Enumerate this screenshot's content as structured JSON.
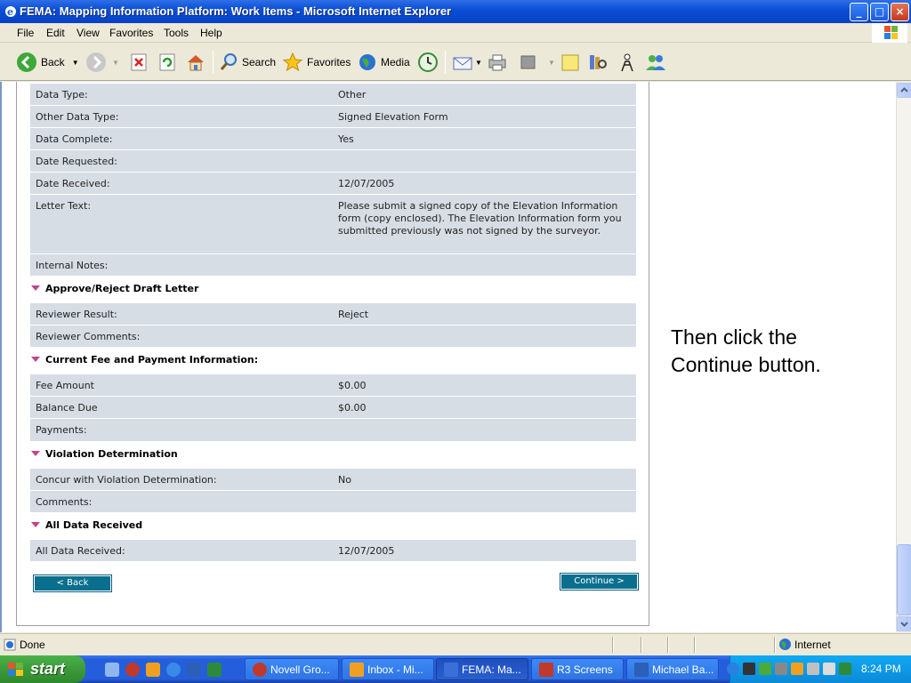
{
  "window": {
    "title": "FEMA: Mapping Information Platform: Work Items - Microsoft Internet Explorer",
    "min_glyph": "_",
    "max_glyph": "□",
    "close_glyph": "×"
  },
  "menu": {
    "items": [
      "File",
      "Edit",
      "View",
      "Favorites",
      "Tools",
      "Help"
    ]
  },
  "toolbar": {
    "back_label": "Back",
    "search_label": "Search",
    "favorites_label": "Favorites",
    "media_label": "Media"
  },
  "form": {
    "rows_top": [
      {
        "label": "Data Type:",
        "value": "Other"
      },
      {
        "label": "Other Data Type:",
        "value": "Signed Elevation Form"
      },
      {
        "label": "Data Complete:",
        "value": "Yes"
      },
      {
        "label": "Date Requested:",
        "value": ""
      },
      {
        "label": "Date Received:",
        "value": "12/07/2005"
      },
      {
        "label": "Letter Text:",
        "value": "Please submit a signed copy of the Elevation Information form (copy enclosed). The Elevation Information form you submitted previously was not signed by the surveyor."
      },
      {
        "label": "Internal Notes:",
        "value": ""
      }
    ],
    "section_approve": {
      "title": "Approve/Reject Draft Letter",
      "rows": [
        {
          "label": "Reviewer Result:",
          "value": "Reject"
        },
        {
          "label": "Reviewer Comments:",
          "value": ""
        }
      ]
    },
    "section_fee": {
      "title": "Current Fee and Payment Information:",
      "rows": [
        {
          "label": "Fee Amount",
          "value": "$0.00"
        },
        {
          "label": "Balance Due",
          "value": "$0.00"
        },
        {
          "label": "Payments:",
          "value": ""
        }
      ]
    },
    "section_violation": {
      "title": "Violation Determination",
      "rows": [
        {
          "label": "Concur with Violation Determination:",
          "value": "No"
        },
        {
          "label": "Comments:",
          "value": ""
        }
      ]
    },
    "section_all_data": {
      "title": "All Data Received",
      "rows": [
        {
          "label": "All Data Received:",
          "value": "12/07/2005"
        }
      ]
    },
    "back_button": "< Back",
    "continue_button": "Continue >"
  },
  "side_note": "Then click the Continue button.",
  "status": {
    "text": "Done",
    "zone": "Internet"
  },
  "taskbar": {
    "start_label": "start",
    "tasks": [
      {
        "label": "Novell Gro...",
        "color": "#c0392b"
      },
      {
        "label": "Inbox - Mi...",
        "color": "#f0a020"
      },
      {
        "label": "FEMA: Ma...",
        "color": "#3a6fd8"
      },
      {
        "label": "R3 Screens",
        "color": "#c0392b"
      },
      {
        "label": "Michael Ba...",
        "color": "#2b5fb8"
      }
    ],
    "clock": "8:24 PM"
  },
  "colors": {
    "row_bg": "#d6dde5",
    "accent_triangle": "#c1448e",
    "button_teal": "#0a6f8e"
  }
}
